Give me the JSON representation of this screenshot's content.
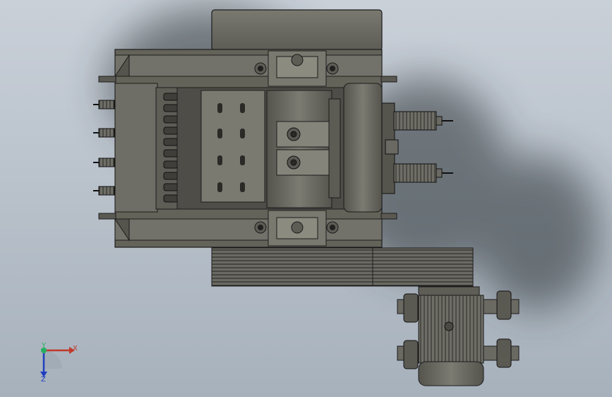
{
  "viewport": {
    "background_top": "#c9d0d8",
    "background_bottom": "#a7b1bc"
  },
  "model": {
    "body_color": "#6b6a62",
    "edge_color": "#1c1c1c",
    "highlight_color": "#8a897f",
    "shadow_color": "#4a4a44"
  },
  "triad": {
    "x_label": "X",
    "y_label": "Y",
    "z_label": "Z",
    "x_color": "#c0392b",
    "y_color": "#27ae60",
    "z_color": "#1f3fbf"
  }
}
